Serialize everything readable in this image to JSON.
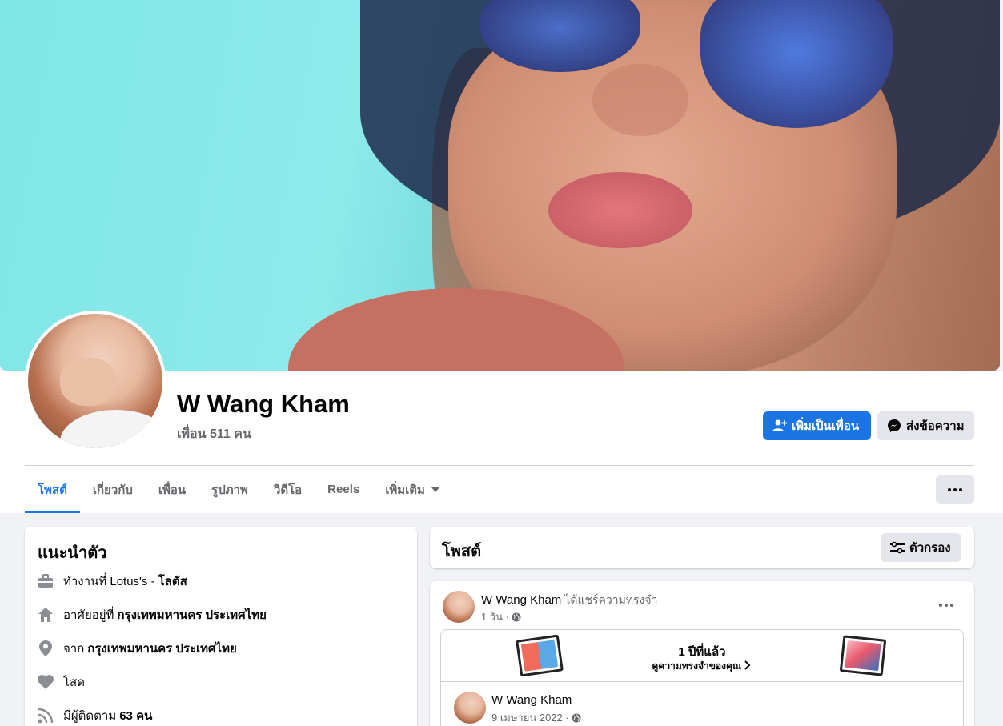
{
  "profile": {
    "name": "W Wang Kham",
    "friends": "เพื่อน 511 คน"
  },
  "actions": {
    "add_friend": "เพิ่มเป็นเพื่อน",
    "message": "ส่งข้อความ"
  },
  "tabs": [
    {
      "label": "โพสต์"
    },
    {
      "label": "เกี่ยวกับ"
    },
    {
      "label": "เพื่อน"
    },
    {
      "label": "รูปภาพ"
    },
    {
      "label": "วิดีโอ"
    },
    {
      "label": "Reels"
    },
    {
      "label": "เพิ่มเติม"
    }
  ],
  "intro": {
    "title": "แนะนำตัว",
    "work_prefix": "ทำงานที่ Lotus's -",
    "work_bold": "โลตัส",
    "lives_prefix": "อาศัยอยู่ที่",
    "lives_bold": "กรุงเทพมหานคร ประเทศไทย",
    "from_prefix": "จาก",
    "from_bold": "กรุงเทพมหานคร ประเทศไทย",
    "relationship": "โสด",
    "followers_prefix": "มีผู้ติดตาม",
    "followers_bold": "63 คน"
  },
  "posts": {
    "title": "โพสต์",
    "filter": "ตัวกรอง"
  },
  "post": {
    "author": "W Wang Kham",
    "action": "ได้แชร์ความทรงจำ",
    "time": "1 วัน ·",
    "memory_title": "1 ปีที่แล้ว",
    "memory_link": "ดูความทรงจำของคุณ",
    "inner_author": "W Wang Kham",
    "inner_date": "9 เมษายน 2022 ·"
  },
  "colors": {
    "accent": "#1b74e4",
    "page_bg": "#f0f2f5",
    "secondary_text": "#65676b"
  }
}
